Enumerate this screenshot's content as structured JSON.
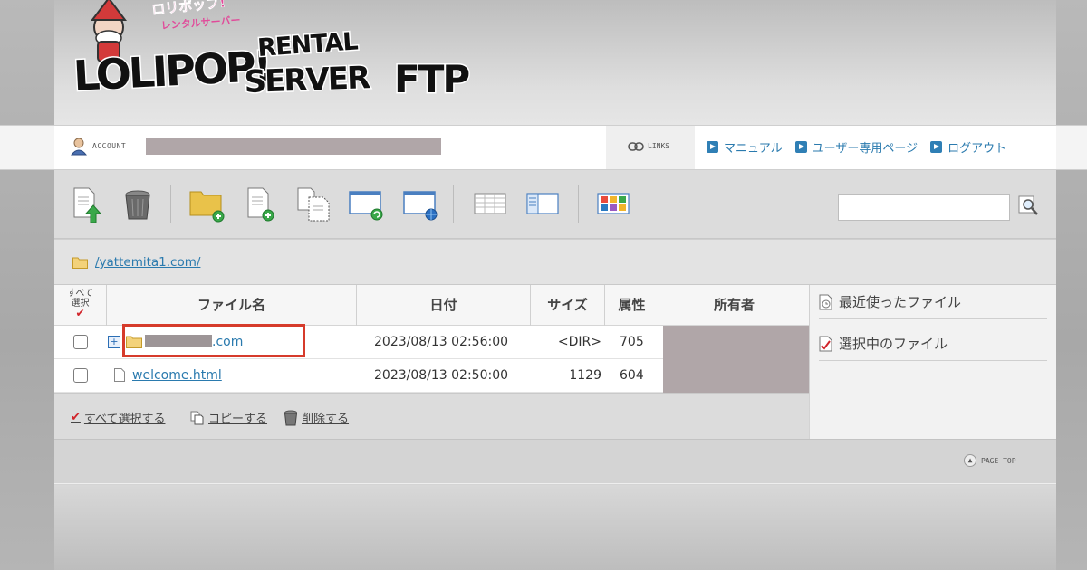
{
  "header": {
    "logo_sub_top": "ロリポップ!",
    "logo_sub_bottom": "レンタルサーバー",
    "logo_main_left": "LOLIPOP!",
    "logo_main_rental": "RENTAL",
    "logo_main_server": "SERVER",
    "logo_main_ftp": "FTP"
  },
  "account": {
    "label": "ACCOUNT",
    "links_label": "LINKS"
  },
  "nav": {
    "manual": "マニュアル",
    "user_page": "ユーザー専用ページ",
    "logout": "ログアウト"
  },
  "toolbar": {
    "icons": [
      "upload-icon",
      "trash-icon",
      "new-folder-icon",
      "new-file-icon",
      "copy-files-icon",
      "refresh-view-icon",
      "web-view-icon",
      "list-view-icon",
      "detail-view-icon",
      "thumbnail-view-icon",
      "search-icon"
    ]
  },
  "path": {
    "current": "/yattemita1.com/"
  },
  "table": {
    "col_select_line1": "すべて",
    "col_select_line2": "選択",
    "col_name": "ファイル名",
    "col_date": "日付",
    "col_size": "サイズ",
    "col_attr": "属性",
    "col_owner": "所有者",
    "rows": [
      {
        "name_suffix": ".com",
        "date": "2023/08/13 02:56:00",
        "size": "<DIR>",
        "attr": "705",
        "type": "folder"
      },
      {
        "name": "welcome.html",
        "date": "2023/08/13 02:50:00",
        "size": "1129",
        "attr": "604",
        "type": "file"
      }
    ]
  },
  "actions": {
    "select_all": "すべて選択する",
    "copy": "コピーする",
    "delete": "削除する"
  },
  "right_panel": {
    "recent": "最近使ったファイル",
    "selected": "選択中のファイル"
  },
  "footer": {
    "pagetop": "PAGE TOP"
  },
  "colors": {
    "link": "#2a7aae",
    "highlight": "#d63b2b",
    "redaction": "#b0a6a8"
  }
}
